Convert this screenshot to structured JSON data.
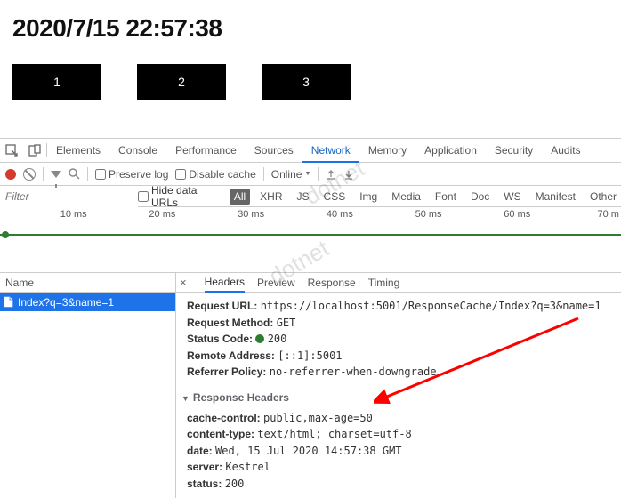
{
  "page": {
    "timestamp": "2020/7/15 22:57:38",
    "boxes": [
      "1",
      "2",
      "3"
    ]
  },
  "devtools": {
    "panels": [
      "Elements",
      "Console",
      "Performance",
      "Sources",
      "Network",
      "Memory",
      "Application",
      "Security",
      "Audits"
    ],
    "active_panel": "Network",
    "toolbar": {
      "preserve_log": "Preserve log",
      "disable_cache": "Disable cache",
      "online": "Online",
      "filter_placeholder": "Filter",
      "hide_data_urls": "Hide data URLs",
      "type_filters": [
        "All",
        "XHR",
        "JS",
        "CSS",
        "Img",
        "Media",
        "Font",
        "Doc",
        "WS",
        "Manifest",
        "Other"
      ],
      "active_type": "All"
    },
    "timeline_ticks": [
      "10 ms",
      "20 ms",
      "30 ms",
      "40 ms",
      "50 ms",
      "60 ms",
      "70 m"
    ],
    "sidebar": {
      "header": "Name",
      "selected_request": "Index?q=3&name=1"
    },
    "request_tabs": [
      "Headers",
      "Preview",
      "Response",
      "Timing"
    ],
    "active_req_tab": "Headers",
    "general": {
      "request_url_label": "Request URL:",
      "request_url": "https://localhost:5001/ResponseCache/Index?q=3&name=1",
      "request_method_label": "Request Method:",
      "request_method": "GET",
      "status_code_label": "Status Code:",
      "status_code": "200",
      "remote_address_label": "Remote Address:",
      "remote_address": "[::1]:5001",
      "referrer_policy_label": "Referrer Policy:",
      "referrer_policy": "no-referrer-when-downgrade"
    },
    "response_headers": {
      "section_label": "Response Headers",
      "cache_control_label": "cache-control:",
      "cache_control": "public,max-age=50",
      "content_type_label": "content-type:",
      "content_type": "text/html; charset=utf-8",
      "date_label": "date:",
      "date": "Wed, 15 Jul 2020 14:57:38 GMT",
      "server_label": "server:",
      "server": "Kestrel",
      "status_label": "status:",
      "status": "200"
    }
  }
}
